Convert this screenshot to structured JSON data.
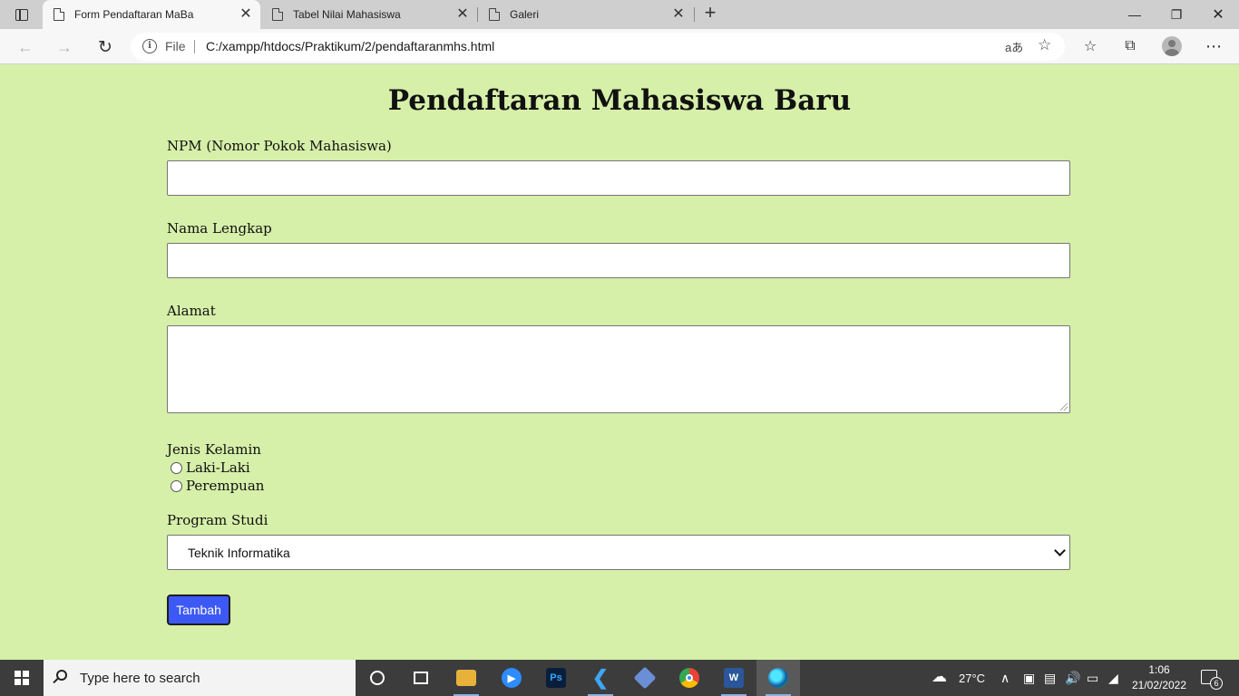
{
  "browser": {
    "tabs": [
      {
        "title": "Form Pendaftaran MaBa",
        "active": true
      },
      {
        "title": "Tabel Nilai Mahasiswa",
        "active": false
      },
      {
        "title": "Galeri",
        "active": false
      }
    ],
    "close_glyph": "✕",
    "new_tab_glyph": "+",
    "address": {
      "scheme_label": "File",
      "url": "C:/xampp/htdocs/Praktikum/2/pendaftaranmhs.html",
      "read_aloud_glyph": "aあ"
    }
  },
  "page": {
    "title": "Pendaftaran Mahasiswa Baru",
    "fields": {
      "npm_label": "NPM (Nomor Pokok Mahasiswa)",
      "npm_value": "",
      "nama_label": "Nama Lengkap",
      "nama_value": "",
      "alamat_label": "Alamat",
      "alamat_value": "",
      "gender_label": "Jenis Kelamin",
      "gender_options": [
        "Laki-Laki",
        "Perempuan"
      ],
      "prodi_label": "Program Studi",
      "prodi_selected": "Teknik Informatika"
    },
    "submit_label": "Tambah"
  },
  "taskbar": {
    "search_placeholder": "Type here to search",
    "apps": [
      "file-explorer",
      "zoom",
      "photoshop",
      "vscode",
      "virtualbox",
      "chrome",
      "word",
      "edge"
    ],
    "photoshop_label": "Ps",
    "word_label": "W",
    "weather": "27°C",
    "time": "1:06",
    "date": "21/02/2022",
    "notification_count": "6"
  },
  "colors": {
    "page_background": "#d6efa9",
    "submit_button": "#3d59f5",
    "taskbar": "#3c3c3c"
  }
}
